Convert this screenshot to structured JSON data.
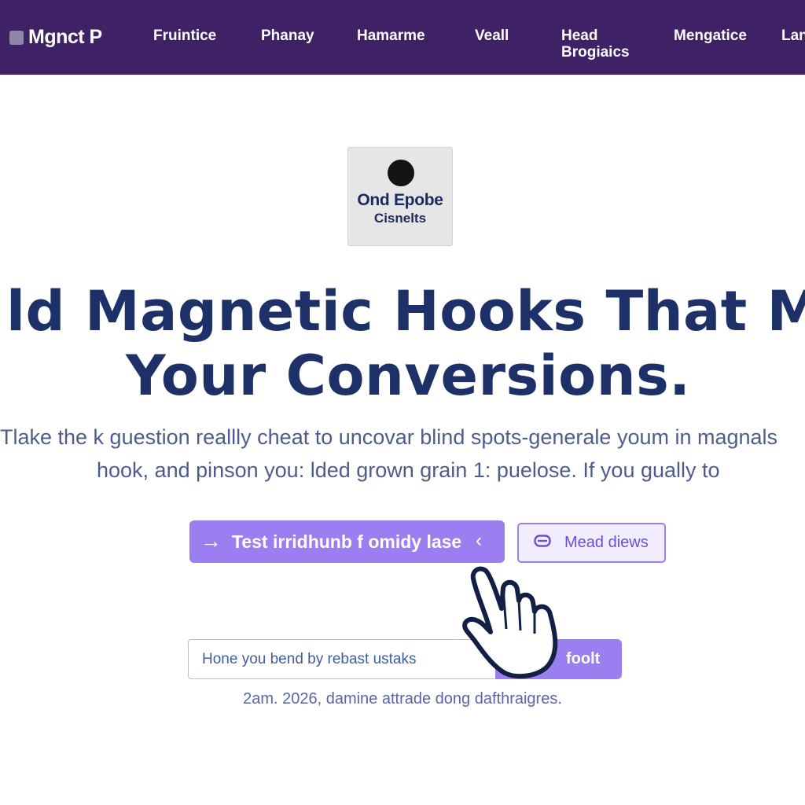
{
  "navbar": {
    "brand": "Mgnct P",
    "links": [
      "Fruintice",
      "Phanay",
      "Hamarme",
      "Veall",
      "Head Brogiaics",
      "Mengatice",
      "Lan"
    ]
  },
  "badge": {
    "title": "Ond Epobe",
    "subtitle": "Cisnelts"
  },
  "hero": {
    "headline_line1": "ld Magnetic Hooks That M",
    "headline_line2": "Your Conversions.",
    "subtext_line1": "Tlake the k guestion reallly cheat to uncovar blind spots-generale youm in magnals",
    "subtext_line2": "hook, and pinson you: lded grown grain 1: puelose. If you gually to"
  },
  "cta": {
    "primary_arrow": "→",
    "primary_label": "Test irridhunb f omidy lase",
    "primary_chevron": "‹",
    "secondary_label": "Mead diews"
  },
  "form": {
    "input_placeholder": "Hone you bend by rebast ustaks",
    "submit_label": "foolt"
  },
  "footnote": "2am. 2026, damine attrade dong dafthraigres.",
  "icons": {
    "brand": "logo-square-icon",
    "secondary_button": "chat-bubble-icon",
    "cursor": "hand-pointer-icon"
  },
  "colors": {
    "nav_bg": "#3f2266",
    "headline": "#1d3068",
    "accent": "#9b7ef0",
    "accent_dark": "#6b4fd6"
  }
}
